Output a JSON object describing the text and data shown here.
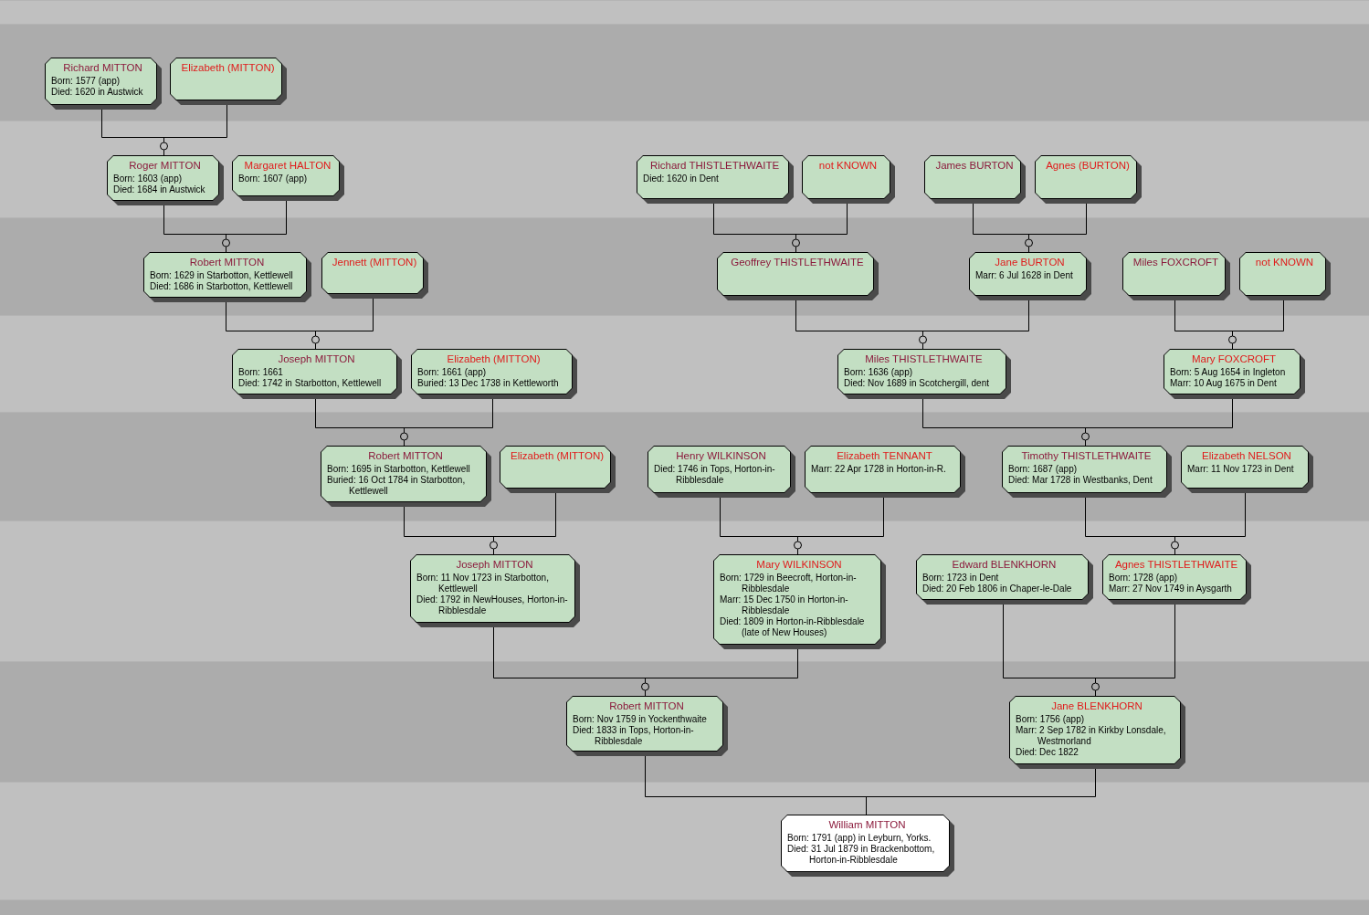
{
  "root": {
    "name": "William MITTON",
    "kind": "male",
    "selected": true,
    "facts": [
      "Born: 1791 (app) in Leyburn, Yorks.",
      "Died: 31 Jul 1879 in Brackenbottom, Horton-in-Ribblesdale"
    ],
    "parents": [
      {
        "name": "Robert MITTON",
        "kind": "male",
        "selected": false,
        "facts": [
          "Born: Nov 1759 in Yockenthwaite",
          "Died: 1833 in Tops, Horton-in-Ribblesdale"
        ],
        "parents": [
          {
            "name": "Joseph MITTON",
            "kind": "male",
            "selected": false,
            "facts": [
              "Born: 11 Nov 1723 in Starbotton, Kettlewell",
              "Died: 1792 in NewHouses, Horton-in-Ribblesdale"
            ],
            "parents": [
              {
                "name": "Robert MITTON",
                "kind": "male",
                "selected": false,
                "facts": [
                  "Born: 1695 in Starbotton, Kettlewell",
                  "Buried: 16 Oct 1784 in Starbotton, Kettlewell"
                ],
                "parents": [
                  {
                    "name": "Joseph MITTON",
                    "kind": "male",
                    "selected": false,
                    "facts": [
                      "Born: 1661",
                      "Died: 1742 in Starbotton, Kettlewell"
                    ],
                    "parents": [
                      {
                        "name": "Robert MITTON",
                        "kind": "male",
                        "selected": false,
                        "facts": [
                          "Born: 1629 in Starbotton, Kettlewell",
                          "Died: 1686 in Starbotton, Kettlewell"
                        ],
                        "parents": [
                          {
                            "name": "Roger MITTON",
                            "kind": "male",
                            "selected": false,
                            "facts": [
                              "Born: 1603 (app)",
                              "Died: 1684 in Austwick"
                            ],
                            "parents": [
                              {
                                "name": "Richard MITTON",
                                "kind": "male",
                                "selected": false,
                                "facts": [
                                  "Born: 1577 (app)",
                                  "Died: 1620 in Austwick"
                                ]
                              },
                              {
                                "name": "Elizabeth (MITTON)",
                                "kind": "female",
                                "selected": false
                              }
                            ]
                          },
                          {
                            "name": "Margaret HALTON",
                            "kind": "female",
                            "selected": false,
                            "facts": [
                              "Born: 1607 (app)"
                            ]
                          }
                        ]
                      },
                      {
                        "name": "Jennett (MITTON)",
                        "kind": "female",
                        "selected": false
                      }
                    ]
                  },
                  {
                    "name": "Elizabeth (MITTON)",
                    "kind": "female",
                    "selected": false,
                    "facts": [
                      "Born: 1661 (app)",
                      "Buried: 13 Dec 1738 in Kettleworth"
                    ]
                  }
                ]
              },
              {
                "name": "Elizabeth (MITTON)",
                "kind": "female",
                "selected": false
              }
            ]
          },
          {
            "name": "Mary WILKINSON",
            "kind": "female",
            "selected": false,
            "facts": [
              "Born: 1729 in Beecroft, Horton-in-Ribblesdale",
              "Marr: 15 Dec 1750 in Horton-in-Ribblesdale",
              "Died: 1809 in Horton-in-Ribblesdale (late of New Houses)"
            ],
            "parents": [
              {
                "name": "Henry WILKINSON",
                "kind": "male",
                "selected": false,
                "facts": [
                  "Died: 1746 in Tops, Horton-in-Ribblesdale"
                ]
              },
              {
                "name": "Elizabeth TENNANT",
                "kind": "female",
                "selected": false,
                "facts": [
                  "Marr: 22 Apr 1728 in Horton-in-R."
                ]
              }
            ]
          }
        ]
      },
      {
        "name": "Jane BLENKHORN",
        "kind": "female",
        "selected": false,
        "facts": [
          "Born: 1756 (app)",
          "Marr: 2 Sep 1782 in Kirkby Lonsdale, Westmorland",
          "Died: Dec 1822"
        ],
        "parents": [
          {
            "name": "Edward BLENKHORN",
            "kind": "male",
            "selected": false,
            "facts": [
              "Born: 1723 in Dent",
              "Died: 20 Feb 1806 in Chaper-le-Dale"
            ]
          },
          {
            "name": "Agnes THISTLETHWAITE",
            "kind": "female",
            "selected": false,
            "facts": [
              "Born: 1728 (app)",
              "Marr: 27 Nov 1749 in Aysgarth"
            ],
            "parents": [
              {
                "name": "Timothy THISTLETHWAITE",
                "kind": "male",
                "selected": false,
                "facts": [
                  "Born: 1687 (app)",
                  "Died: Mar 1728 in Westbanks, Dent"
                ],
                "parents": [
                  {
                    "name": "Miles THISTLETHWAITE",
                    "kind": "male",
                    "selected": false,
                    "facts": [
                      "Born: 1636 (app)",
                      "Died: Nov 1689 in Scotchergill, dent"
                    ],
                    "parents": [
                      {
                        "name": "Geoffrey THISTLETHWAITE",
                        "kind": "male",
                        "selected": false,
                        "parents": [
                          {
                            "name": "Richard THISTLETHWAITE",
                            "kind": "male",
                            "selected": false,
                            "facts": [
                              "Died: 1620 in Dent"
                            ]
                          },
                          {
                            "name": "not KNOWN",
                            "kind": "female",
                            "selected": false
                          }
                        ]
                      },
                      {
                        "name": "Jane BURTON",
                        "kind": "female",
                        "selected": false,
                        "facts": [
                          "Marr: 6 Jul 1628 in Dent"
                        ],
                        "parents": [
                          {
                            "name": "James BURTON",
                            "kind": "male",
                            "selected": false
                          },
                          {
                            "name": "Agnes (BURTON)",
                            "kind": "female",
                            "selected": false
                          }
                        ]
                      }
                    ]
                  },
                  {
                    "name": "Mary FOXCROFT",
                    "kind": "female",
                    "selected": false,
                    "facts": [
                      "Born: 5 Aug 1654 in Ingleton",
                      "Marr: 10 Aug 1675 in Dent"
                    ],
                    "parents": [
                      {
                        "name": "Miles FOXCROFT",
                        "kind": "male",
                        "selected": false
                      },
                      {
                        "name": "not KNOWN",
                        "kind": "female",
                        "selected": false
                      }
                    ]
                  }
                ]
              },
              {
                "name": "Elizabeth NELSON",
                "kind": "female",
                "selected": false,
                "facts": [
                  "Marr: 11 Nov 1723 in Dent"
                ]
              }
            ]
          }
        ]
      }
    ]
  }
}
